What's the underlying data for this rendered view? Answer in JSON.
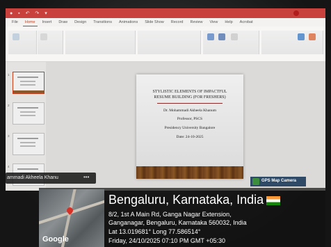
{
  "powerpoint": {
    "tabs": [
      "File",
      "Home",
      "Insert",
      "Draw",
      "Design",
      "Transitions",
      "Animations",
      "Slide Show",
      "Record",
      "Review",
      "View",
      "Help",
      "Acrobat"
    ],
    "active_tab": "Home",
    "slide_numbers": [
      "1",
      "2",
      "3",
      "4"
    ]
  },
  "slide": {
    "title_line1": "STYLISTIC ELEMENTS OF IMPACTFUL",
    "title_line2": "RESUME BUILDING (FOR FRESHERS)",
    "author": "Dr. Mohammadi Akheela Khanum",
    "role": "Professor, PSCS",
    "institution": "Presidency University Bangalore",
    "date": "Date: 24-10-2025"
  },
  "participant": {
    "name": "ammadi Akheela Khanu",
    "more_label": "•••"
  },
  "gps": {
    "badge": "GPS Map Camera",
    "city": "Bengaluru, Karnataka, India",
    "address_line1": "8/2, 1st A Main Rd, Ganga Nagar Extension,",
    "address_line2": "Ganganagar, Bengaluru, Karnataka 560032, India",
    "coords": "Lat 13.019681° Long 77.586514°",
    "datetime": "Friday, 24/10/2025 07:10 PM GMT +05:30",
    "map_logo": "Google"
  },
  "colors": {
    "accent": "#c43e1c",
    "titlebar": "#c9413c",
    "badge": "#2f4a66"
  }
}
